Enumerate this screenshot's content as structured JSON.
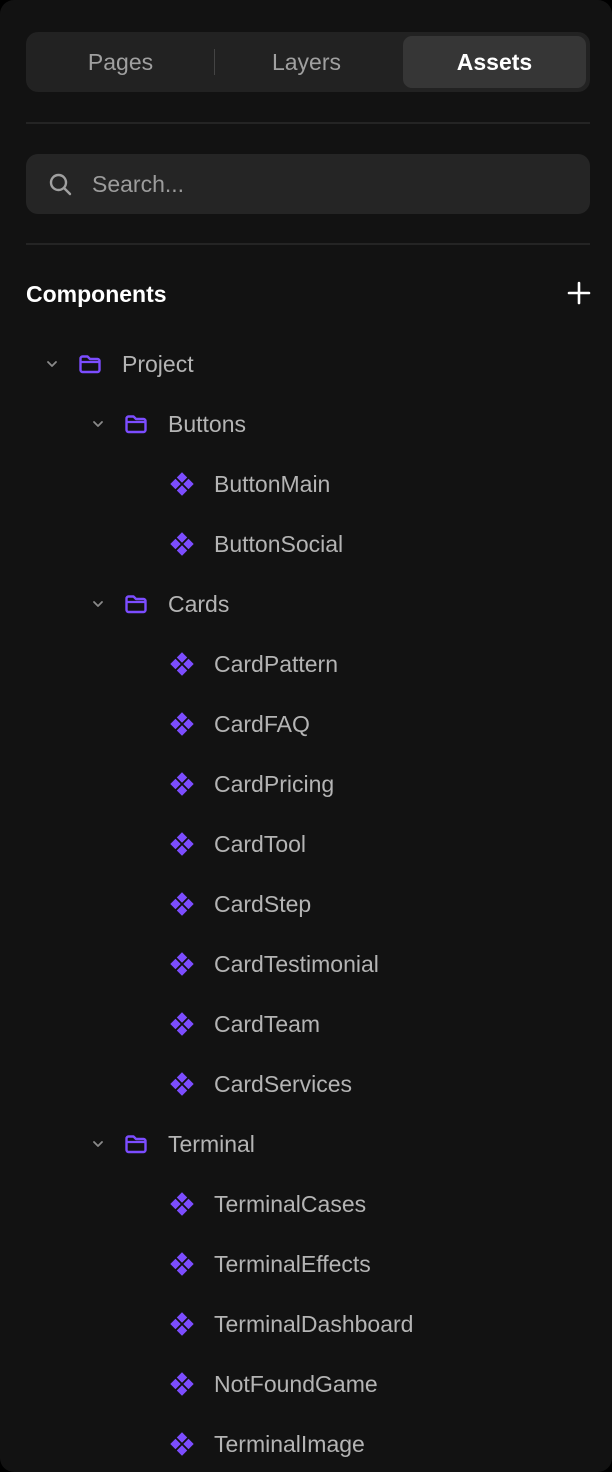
{
  "tabs": [
    {
      "label": "Pages",
      "active": false
    },
    {
      "label": "Layers",
      "active": false
    },
    {
      "label": "Assets",
      "active": true
    }
  ],
  "search": {
    "placeholder": "Search..."
  },
  "components": {
    "title": "Components",
    "add_icon": "plus-icon",
    "project": {
      "label": "Project",
      "folders": [
        {
          "label": "Buttons",
          "items": [
            "ButtonMain",
            "ButtonSocial"
          ]
        },
        {
          "label": "Cards",
          "items": [
            "CardPattern",
            "CardFAQ",
            "CardPricing",
            "CardTool",
            "CardStep",
            "CardTestimonial",
            "CardTeam",
            "CardServices"
          ]
        },
        {
          "label": "Terminal",
          "items": [
            "TerminalCases",
            "TerminalEffects",
            "TerminalDashboard",
            "NotFoundGame",
            "TerminalImage"
          ]
        }
      ]
    }
  },
  "colors": {
    "accent": "#7c4dff",
    "background": "#121212",
    "text": "#b4b4b4"
  }
}
